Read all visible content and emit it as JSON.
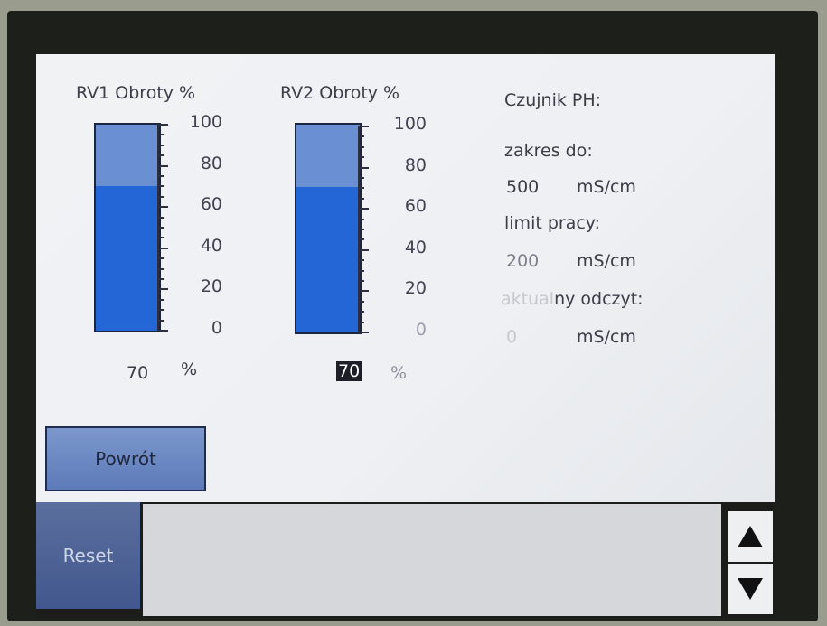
{
  "gauges": [
    {
      "title": "RV1 Obroty %",
      "level_percent": 70,
      "value": "70",
      "unit": "%",
      "ticks": [
        "100",
        "80",
        "60",
        "40",
        "20",
        "0"
      ]
    },
    {
      "title": "RV2 Obroty %",
      "level_percent": 70,
      "value": "70",
      "unit": "%",
      "ticks": [
        "100",
        "80",
        "60",
        "40",
        "20",
        "0"
      ]
    }
  ],
  "sensor": {
    "title": "Czujnik PH:",
    "range_label": "zakres do:",
    "range_value": "500",
    "range_unit": "mS/cm",
    "limit_label": "limit pracy:",
    "limit_value": "200",
    "limit_unit": "mS/cm",
    "current_label_faded": "aktual",
    "current_label_rest": "ny odczyt:",
    "current_value": "0",
    "current_unit": "mS/cm"
  },
  "buttons": {
    "back": "Powrót",
    "reset": "Reset"
  },
  "colors": {
    "bar_fill": "#2466d6",
    "bar_track": "#6b8fd3",
    "button": "#6d89c2"
  },
  "icons": {
    "scroll_up": "triangle-up-icon",
    "scroll_down": "triangle-down-icon"
  }
}
